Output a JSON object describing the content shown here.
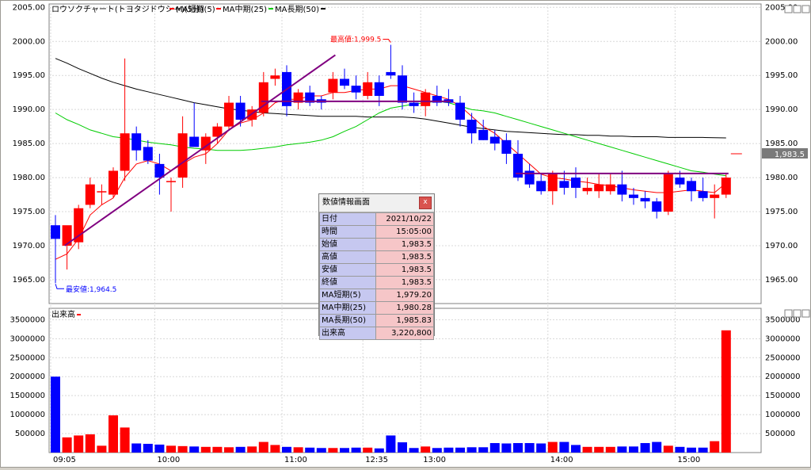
{
  "legend": {
    "price_title": "ロウソクチャート(トヨタジドウシャ)(5分)",
    "ma_short_label": "MA短期(5)",
    "ma_mid_label": "MA中期(25)",
    "ma_long_label": "MA長期(50)",
    "volume_title": "出来高"
  },
  "annotations": {
    "high_label": "最高値:1,999.5",
    "low_label": "最安値:1,964.5",
    "current_price_label": "1,983.5"
  },
  "colors": {
    "up": "#ff0000",
    "down": "#0000ff",
    "ma_short": "#ff0000",
    "ma_mid": "#00cc00",
    "ma_long": "#000000",
    "trendline": "#800080"
  },
  "info_panel": {
    "title": "数値情報画面",
    "close": "x",
    "rows": [
      {
        "label": "日付",
        "value": "2021/10/22"
      },
      {
        "label": "時間",
        "value": "15:05:00"
      },
      {
        "label": "始値",
        "value": "1,983.5"
      },
      {
        "label": "高値",
        "value": "1,983.5"
      },
      {
        "label": "安値",
        "value": "1,983.5"
      },
      {
        "label": "終値",
        "value": "1,983.5"
      },
      {
        "label": "MA短期(5)",
        "value": "1,979.20"
      },
      {
        "label": "MA中期(25)",
        "value": "1,980.28"
      },
      {
        "label": "MA長期(50)",
        "value": "1,985.83"
      },
      {
        "label": "出来高",
        "value": "3,220,800"
      }
    ]
  },
  "chart_data": {
    "type": "candlestick",
    "price_axis": {
      "ylim": [
        1961.5,
        2005.5
      ],
      "ticks": [
        "1965.00",
        "1970.00",
        "1975.00",
        "1980.00",
        "1985.00",
        "1990.00",
        "1995.00",
        "2000.00",
        "2005.00"
      ],
      "tick_values": [
        1965,
        1970,
        1975,
        1980,
        1985,
        1990,
        1995,
        2000,
        2005
      ]
    },
    "volume_axis": {
      "ylim": [
        0,
        3800000
      ],
      "ticks": [
        "500000",
        "1000000",
        "1500000",
        "2000000",
        "2500000",
        "3000000",
        "3500000"
      ],
      "tick_values": [
        500000,
        1000000,
        1500000,
        2000000,
        2500000,
        3000000,
        3500000
      ]
    },
    "x_labels": [
      {
        "index": 0,
        "label": "09:05"
      },
      {
        "index": 9,
        "label": "10:00"
      },
      {
        "index": 20,
        "label": "11:00"
      },
      {
        "index": 27,
        "label": "12:35"
      },
      {
        "index": 32,
        "label": "13:00"
      },
      {
        "index": 43,
        "label": "14:00"
      },
      {
        "index": 54,
        "label": "15:00"
      }
    ],
    "candles": [
      {
        "o": 1973.0,
        "h": 1974.5,
        "l": 1964.5,
        "c": 1971.0
      },
      {
        "o": 1970.0,
        "h": 1972.5,
        "l": 1966.5,
        "c": 1973.0
      },
      {
        "o": 1970.5,
        "h": 1976.0,
        "l": 1969.5,
        "c": 1975.5
      },
      {
        "o": 1976.0,
        "h": 1980.0,
        "l": 1975.5,
        "c": 1979.0
      },
      {
        "o": 1978.0,
        "h": 1979.0,
        "l": 1976.0,
        "c": 1978.0
      },
      {
        "o": 1977.5,
        "h": 1981.5,
        "l": 1977.0,
        "c": 1981.0
      },
      {
        "o": 1981.0,
        "h": 1997.5,
        "l": 1979.5,
        "c": 1986.5
      },
      {
        "o": 1986.5,
        "h": 1987.5,
        "l": 1982.5,
        "c": 1984.0
      },
      {
        "o": 1984.5,
        "h": 1985.5,
        "l": 1982.0,
        "c": 1982.5
      },
      {
        "o": 1982.0,
        "h": 1983.5,
        "l": 1977.5,
        "c": 1980.0
      },
      {
        "o": 1979.5,
        "h": 1980.0,
        "l": 1975.0,
        "c": 1979.5
      },
      {
        "o": 1980.0,
        "h": 1989.0,
        "l": 1978.5,
        "c": 1986.5
      },
      {
        "o": 1986.0,
        "h": 1991.0,
        "l": 1985.0,
        "c": 1984.5
      },
      {
        "o": 1984.0,
        "h": 1986.5,
        "l": 1982.0,
        "c": 1986.0
      },
      {
        "o": 1986.0,
        "h": 1988.0,
        "l": 1985.0,
        "c": 1987.5
      },
      {
        "o": 1987.5,
        "h": 1992.0,
        "l": 1987.0,
        "c": 1991.0
      },
      {
        "o": 1991.0,
        "h": 1992.0,
        "l": 1987.5,
        "c": 1988.5
      },
      {
        "o": 1988.5,
        "h": 1990.5,
        "l": 1987.5,
        "c": 1990.0
      },
      {
        "o": 1989.5,
        "h": 1995.5,
        "l": 1989.0,
        "c": 1994.0
      },
      {
        "o": 1994.5,
        "h": 1996.0,
        "l": 1993.5,
        "c": 1995.0
      },
      {
        "o": 1995.5,
        "h": 1996.5,
        "l": 1989.0,
        "c": 1990.5
      },
      {
        "o": 1991.0,
        "h": 1993.0,
        "l": 1990.0,
        "c": 1992.5
      },
      {
        "o": 1992.5,
        "h": 1993.5,
        "l": 1990.5,
        "c": 1991.0
      },
      {
        "o": 1991.5,
        "h": 1992.0,
        "l": 1990.0,
        "c": 1991.0
      },
      {
        "o": 1992.5,
        "h": 1995.5,
        "l": 1991.5,
        "c": 1994.5
      },
      {
        "o": 1994.5,
        "h": 1996.0,
        "l": 1993.0,
        "c": 1993.5
      },
      {
        "o": 1993.5,
        "h": 1995.0,
        "l": 1991.5,
        "c": 1992.5
      },
      {
        "o": 1992.0,
        "h": 1995.5,
        "l": 1991.5,
        "c": 1994.0
      },
      {
        "o": 1994.0,
        "h": 1995.0,
        "l": 1990.5,
        "c": 1992.0
      },
      {
        "o": 1995.5,
        "h": 1999.5,
        "l": 1994.5,
        "c": 1995.0
      },
      {
        "o": 1995.0,
        "h": 1996.5,
        "l": 1990.0,
        "c": 1991.0
      },
      {
        "o": 1991.0,
        "h": 1992.5,
        "l": 1989.5,
        "c": 1990.5
      },
      {
        "o": 1990.5,
        "h": 1993.0,
        "l": 1989.0,
        "c": 1992.5
      },
      {
        "o": 1992.0,
        "h": 1993.5,
        "l": 1990.5,
        "c": 1991.0
      },
      {
        "o": 1991.5,
        "h": 1993.0,
        "l": 1990.5,
        "c": 1991.0
      },
      {
        "o": 1991.0,
        "h": 1992.0,
        "l": 1987.5,
        "c": 1988.5
      },
      {
        "o": 1988.5,
        "h": 1989.5,
        "l": 1985.0,
        "c": 1986.5
      },
      {
        "o": 1987.0,
        "h": 1988.5,
        "l": 1985.5,
        "c": 1985.5
      },
      {
        "o": 1986.0,
        "h": 1987.0,
        "l": 1984.0,
        "c": 1985.0
      },
      {
        "o": 1985.5,
        "h": 1986.5,
        "l": 1982.0,
        "c": 1983.5
      },
      {
        "o": 1983.5,
        "h": 1985.5,
        "l": 1979.5,
        "c": 1980.0
      },
      {
        "o": 1981.0,
        "h": 1982.0,
        "l": 1978.5,
        "c": 1979.0
      },
      {
        "o": 1979.5,
        "h": 1980.5,
        "l": 1977.5,
        "c": 1978.0
      },
      {
        "o": 1978.0,
        "h": 1981.0,
        "l": 1976.0,
        "c": 1980.5
      },
      {
        "o": 1979.5,
        "h": 1981.0,
        "l": 1977.5,
        "c": 1978.5
      },
      {
        "o": 1980.0,
        "h": 1981.5,
        "l": 1977.0,
        "c": 1978.5
      },
      {
        "o": 1978.0,
        "h": 1980.0,
        "l": 1977.5,
        "c": 1978.5
      },
      {
        "o": 1978.0,
        "h": 1980.5,
        "l": 1977.0,
        "c": 1979.0
      },
      {
        "o": 1978.0,
        "h": 1980.5,
        "l": 1977.5,
        "c": 1979.0
      },
      {
        "o": 1979.0,
        "h": 1981.0,
        "l": 1976.5,
        "c": 1977.5
      },
      {
        "o": 1977.5,
        "h": 1978.5,
        "l": 1976.0,
        "c": 1977.0
      },
      {
        "o": 1977.0,
        "h": 1978.0,
        "l": 1975.5,
        "c": 1976.5
      },
      {
        "o": 1976.5,
        "h": 1977.0,
        "l": 1974.0,
        "c": 1975.0
      },
      {
        "o": 1975.0,
        "h": 1981.0,
        "l": 1974.5,
        "c": 1980.5
      },
      {
        "o": 1980.0,
        "h": 1981.0,
        "l": 1978.5,
        "c": 1979.0
      },
      {
        "o": 1979.5,
        "h": 1980.0,
        "l": 1976.5,
        "c": 1978.0
      },
      {
        "o": 1978.0,
        "h": 1980.0,
        "l": 1976.5,
        "c": 1977.0
      },
      {
        "o": 1977.0,
        "h": 1979.0,
        "l": 1974.0,
        "c": 1977.5
      },
      {
        "o": 1977.5,
        "h": 1980.5,
        "l": 1977.0,
        "c": 1980.0
      }
    ],
    "volume": [
      2000000,
      400000,
      450000,
      480000,
      180000,
      980000,
      660000,
      240000,
      230000,
      210000,
      180000,
      170000,
      160000,
      150000,
      150000,
      140000,
      150000,
      160000,
      280000,
      200000,
      150000,
      140000,
      130000,
      120000,
      120000,
      120000,
      130000,
      130000,
      110000,
      450000,
      270000,
      120000,
      160000,
      120000,
      130000,
      130000,
      140000,
      140000,
      250000,
      240000,
      250000,
      250000,
      240000,
      280000,
      280000,
      200000,
      150000,
      150000,
      150000,
      160000,
      160000,
      250000,
      280000,
      180000,
      150000,
      130000,
      130000,
      300000,
      3220000
    ],
    "ma_short": [
      1968.0,
      1968.8,
      1971.0,
      1974.5,
      1976.0,
      1977.0,
      1980.0,
      1982.0,
      1982.5,
      1982.0,
      1981.0,
      1982.0,
      1983.0,
      1983.5,
      1985.0,
      1987.0,
      1988.0,
      1988.5,
      1989.5,
      1991.0,
      1991.5,
      1991.5,
      1992.0,
      1992.0,
      1992.5,
      1992.5,
      1992.8,
      1993.0,
      1993.0,
      1993.5,
      1993.5,
      1993.0,
      1992.5,
      1992.0,
      1991.5,
      1990.5,
      1989.0,
      1987.5,
      1986.5,
      1985.0,
      1983.5,
      1982.0,
      1980.5,
      1980.0,
      1979.8,
      1979.5,
      1979.3,
      1979.0,
      1978.8,
      1978.5,
      1978.2,
      1978.0,
      1977.8,
      1977.8,
      1978.0,
      1978.2,
      1978.0,
      1977.8,
      1979.2
    ],
    "ma_mid": [
      1989.5,
      1988.5,
      1987.8,
      1987.0,
      1986.5,
      1986.0,
      1985.8,
      1985.5,
      1985.2,
      1985.0,
      1984.8,
      1984.5,
      1984.3,
      1984.2,
      1984.0,
      1984.0,
      1984.0,
      1984.1,
      1984.3,
      1984.5,
      1984.8,
      1985.0,
      1985.2,
      1985.5,
      1986.0,
      1986.8,
      1987.5,
      1988.5,
      1989.5,
      1990.2,
      1990.5,
      1990.8,
      1991.0,
      1991.2,
      1991.0,
      1990.5,
      1990.0,
      1989.8,
      1989.5,
      1989.0,
      1988.5,
      1988.0,
      1987.5,
      1987.0,
      1986.5,
      1986.0,
      1985.5,
      1985.0,
      1984.5,
      1984.0,
      1983.5,
      1983.0,
      1982.5,
      1982.0,
      1981.5,
      1981.0,
      1980.8,
      1980.5,
      1980.28
    ],
    "ma_long": [
      1997.5,
      1996.8,
      1996.0,
      1995.3,
      1994.6,
      1994.0,
      1993.5,
      1993.0,
      1992.6,
      1992.2,
      1991.8,
      1991.4,
      1991.0,
      1990.7,
      1990.4,
      1990.1,
      1989.9,
      1989.7,
      1989.5,
      1989.4,
      1989.3,
      1989.2,
      1989.1,
      1989.0,
      1989.0,
      1989.0,
      1989.0,
      1988.9,
      1988.9,
      1988.9,
      1988.9,
      1988.8,
      1988.6,
      1988.3,
      1988.0,
      1987.7,
      1987.4,
      1987.2,
      1987.0,
      1986.8,
      1986.7,
      1986.6,
      1986.5,
      1986.4,
      1986.3,
      1986.3,
      1986.2,
      1986.2,
      1986.1,
      1986.1,
      1986.0,
      1986.0,
      1986.0,
      1985.9,
      1985.9,
      1985.9,
      1985.9,
      1985.85,
      1985.83
    ],
    "trendlines": [
      {
        "from": {
          "index": 1,
          "price": 1970.0
        },
        "to": {
          "index": 24,
          "price": 1998.0
        }
      },
      {
        "from": {
          "index": 18,
          "price": 1991.2
        },
        "to": {
          "index": 34,
          "price": 1991.2
        }
      },
      {
        "from": {
          "index": 40,
          "price": 1980.6
        },
        "to": {
          "index": 58,
          "price": 1980.6
        }
      }
    ]
  }
}
